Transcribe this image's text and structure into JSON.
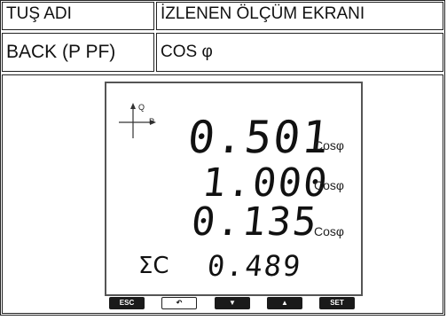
{
  "table": {
    "header_key": "TUŞ ADI",
    "header_screen": "İZLENEN ÖLÇÜM EKRANI",
    "row_key": "BACK (P PF)",
    "row_screen": "COS φ"
  },
  "display": {
    "axis_label_q": "Q",
    "axis_label_p": "P",
    "line1_value": "0.501",
    "line1_unit": "Cosφ",
    "line2_value": "1.000",
    "line2_unit": "Cosφ",
    "line3_value": "0.135",
    "line3_unit": "Cosφ",
    "sum_symbol": "ΣC",
    "sum_value": "0.489"
  },
  "buttons": {
    "esc_label": "ESC",
    "back_label": "↶",
    "down_label": "▼",
    "up_label": "▲",
    "set_label": "SET"
  }
}
